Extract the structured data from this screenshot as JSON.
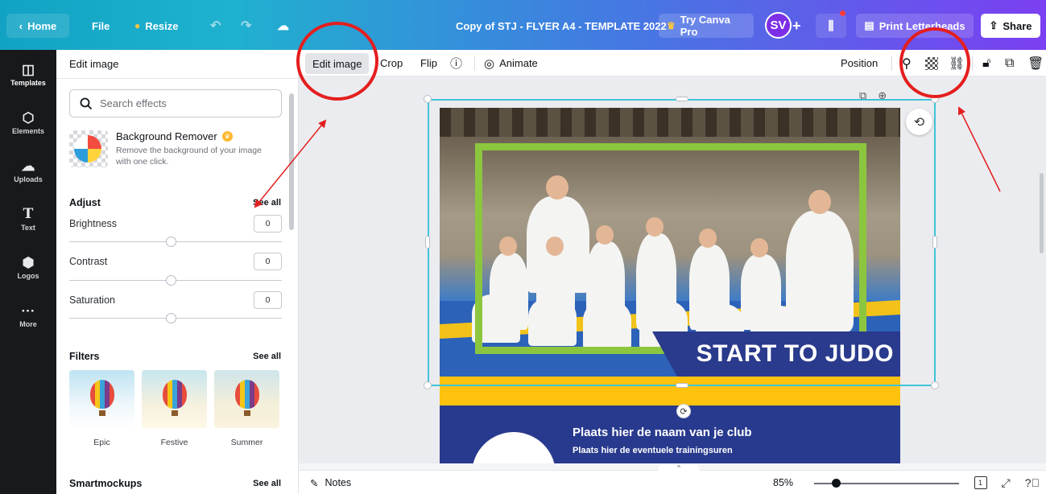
{
  "topbar": {
    "home": "Home",
    "file": "File",
    "resize": "Resize",
    "doc_title": "Copy of STJ - FLYER A4 - TEMPLATE 2022",
    "try_pro": "Try Canva Pro",
    "avatar": "SV",
    "add": "+",
    "print": "Print Letterheads",
    "share": "Share"
  },
  "rail": {
    "items": [
      {
        "label": "Templates",
        "icon": "templates-icon"
      },
      {
        "label": "Elements",
        "icon": "elements-icon"
      },
      {
        "label": "Uploads",
        "icon": "uploads-icon"
      },
      {
        "label": "Text",
        "icon": "text-icon"
      },
      {
        "label": "Logos",
        "icon": "logos-icon"
      },
      {
        "label": "More",
        "icon": "more-icon"
      }
    ]
  },
  "panel": {
    "title": "Edit image",
    "search_placeholder": "Search effects",
    "bg_remover": {
      "title": "Background Remover",
      "desc": "Remove the background of your image with one click."
    },
    "adjust": {
      "title": "Adjust",
      "see_all": "See all",
      "rows": [
        {
          "label": "Brightness",
          "value": "0"
        },
        {
          "label": "Contrast",
          "value": "0"
        },
        {
          "label": "Saturation",
          "value": "0"
        }
      ]
    },
    "filters": {
      "title": "Filters",
      "see_all": "See all",
      "items": [
        "Epic",
        "Festive",
        "Summer"
      ]
    },
    "smartmockups": {
      "title": "Smartmockups",
      "see_all": "See all"
    }
  },
  "context": {
    "edit_image": "Edit image",
    "crop": "Crop",
    "flip": "Flip",
    "animate": "Animate",
    "position": "Position"
  },
  "flyer": {
    "headline": "START TO JUDO",
    "club": "Plaats hier de naam van je club",
    "hours": "Plaats hier de eventuele trainingsuren"
  },
  "bottom": {
    "notes": "Notes",
    "zoom": "85%",
    "page_count": "1"
  },
  "colors": {
    "accent_teal": "#1fb1cf",
    "accent_purple": "#7b3ff2",
    "annotation_red": "#e41e1e",
    "flyer_navy": "#283a8e",
    "flyer_yellow": "#fec20f",
    "frame_green": "#8cc63f"
  }
}
